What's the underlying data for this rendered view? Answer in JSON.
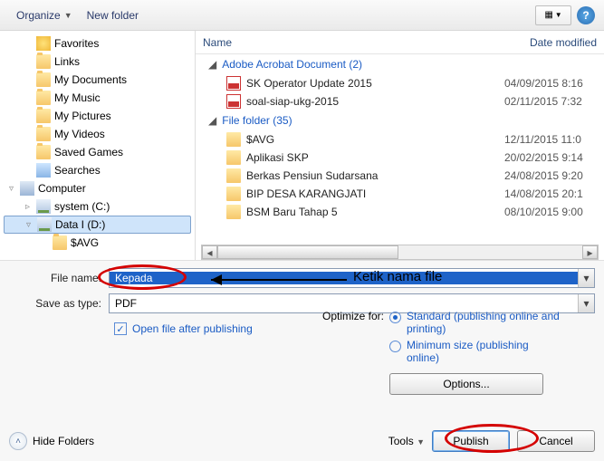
{
  "toolbar": {
    "organize": "Organize",
    "newfolder": "New folder"
  },
  "tree": {
    "items": [
      {
        "label": "Favorites",
        "icon": "star"
      },
      {
        "label": "Links",
        "icon": "folder"
      },
      {
        "label": "My Documents",
        "icon": "folder"
      },
      {
        "label": "My Music",
        "icon": "folder"
      },
      {
        "label": "My Pictures",
        "icon": "folder"
      },
      {
        "label": "My Videos",
        "icon": "folder"
      },
      {
        "label": "Saved Games",
        "icon": "folder"
      },
      {
        "label": "Searches",
        "icon": "search"
      },
      {
        "label": "Computer",
        "icon": "computer",
        "indent": 0,
        "twisty": "▿"
      },
      {
        "label": "system (C:)",
        "icon": "drive",
        "indent": 1,
        "twisty": "▹"
      },
      {
        "label": "Data I (D:)",
        "icon": "drive",
        "indent": 1,
        "twisty": "▿",
        "selected": true
      },
      {
        "label": "$AVG",
        "icon": "folder",
        "indent": 2
      }
    ]
  },
  "headers": {
    "name": "Name",
    "date": "Date modified"
  },
  "groups": [
    {
      "label": "Adobe Acrobat Document (2)",
      "items": [
        {
          "name": "SK Operator Update 2015",
          "date": "04/09/2015 8:16",
          "icon": "pdf"
        },
        {
          "name": "soal-siap-ukg-2015",
          "date": "02/11/2015 7:32",
          "icon": "pdf"
        }
      ]
    },
    {
      "label": "File folder (35)",
      "items": [
        {
          "name": "$AVG",
          "date": "12/11/2015 11:0",
          "icon": "folder"
        },
        {
          "name": "Aplikasi SKP",
          "date": "20/02/2015 9:14",
          "icon": "folder"
        },
        {
          "name": "Berkas Pensiun Sudarsana",
          "date": "24/08/2015 9:20",
          "icon": "folder"
        },
        {
          "name": "BIP DESA KARANGJATI",
          "date": "14/08/2015 20:1",
          "icon": "folder"
        },
        {
          "name": "BSM Baru Tahap 5",
          "date": "08/10/2015 9:00",
          "icon": "folder"
        }
      ]
    }
  ],
  "form": {
    "filename_label": "File name:",
    "filename_value": "Kepada",
    "saveastype_label": "Save as type:",
    "saveastype_value": "PDF",
    "open_after": "Open file after publishing",
    "optimize_label": "Optimize for:",
    "opt_standard": "Standard (publishing online and printing)",
    "opt_min": "Minimum size (publishing online)",
    "options_btn": "Options...",
    "tools": "Tools",
    "publish": "Publish",
    "cancel": "Cancel",
    "hide_folders": "Hide Folders"
  },
  "annotation": {
    "text": "Ketik nama file"
  }
}
